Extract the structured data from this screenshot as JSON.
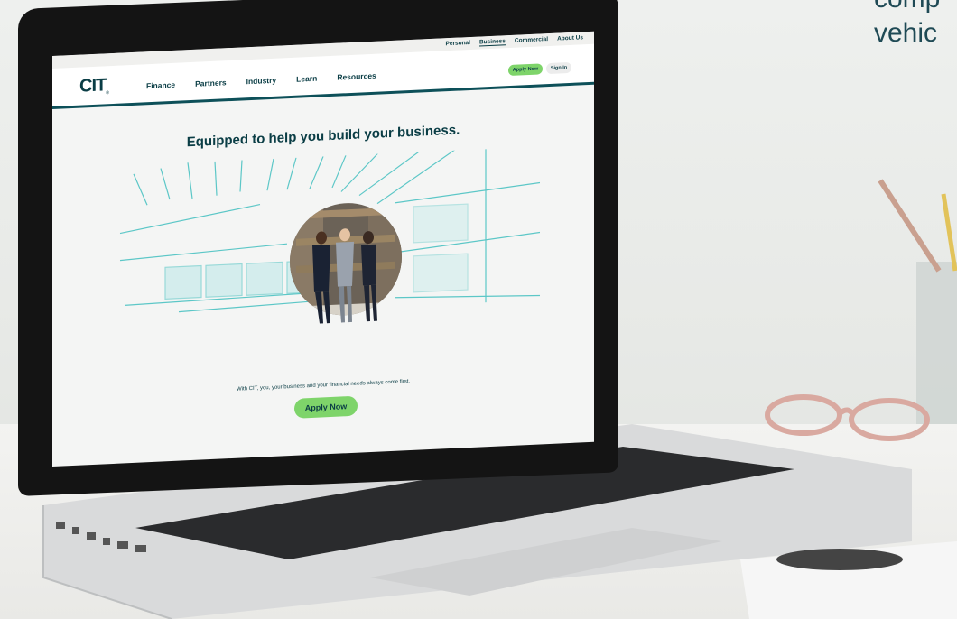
{
  "background_text": {
    "line1": "comp",
    "line2": "vehic"
  },
  "site": {
    "logo": "CIT",
    "top_nav": [
      "Personal",
      "Business",
      "Commercial",
      "About Us"
    ],
    "top_nav_active": "Business",
    "main_nav": [
      "Finance",
      "Partners",
      "Industry",
      "Learn",
      "Resources"
    ],
    "apply_now_small": "Apply Now",
    "sign_in": "Sign In",
    "hero_title": "Equipped to help you build your business.",
    "hero_subtitle": "With CIT, you, your business and your financial needs always come first.",
    "apply_now": "Apply Now"
  },
  "colors": {
    "brand_dark": "#0a3d45",
    "accent_green": "#7ed46a",
    "teal_line": "#5cc7c7"
  }
}
